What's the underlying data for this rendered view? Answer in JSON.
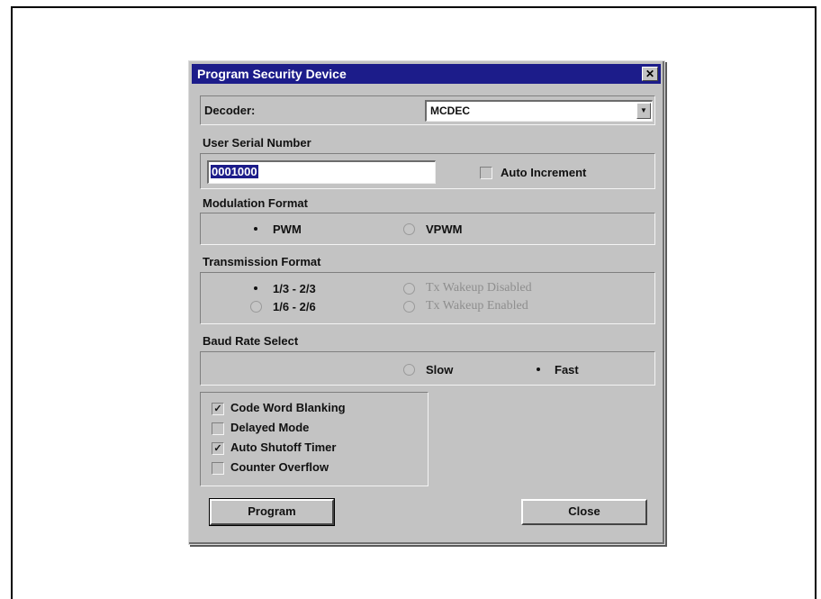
{
  "dialog": {
    "title": "Program Security Device",
    "close_glyph": "✕"
  },
  "decoder": {
    "label": "Decoder:",
    "value": "MCDEC",
    "arrow_glyph": "▼"
  },
  "serial": {
    "label": "User Serial Number",
    "value": "0001000",
    "auto_increment_label": "Auto Increment",
    "auto_increment_checked": false
  },
  "modulation": {
    "label": "Modulation Format",
    "options": [
      {
        "label": "PWM",
        "selected": true,
        "enabled": true
      },
      {
        "label": "VPWM",
        "selected": false,
        "enabled": true
      }
    ]
  },
  "transmission": {
    "label": "Transmission Format",
    "options": [
      {
        "label": "1/3 - 2/3",
        "selected": true,
        "enabled": true
      },
      {
        "label": "1/6 - 2/6",
        "selected": false,
        "enabled": true
      },
      {
        "label": "Tx Wakeup Disabled",
        "selected": false,
        "enabled": false
      },
      {
        "label": "Tx Wakeup Enabled",
        "selected": false,
        "enabled": false
      }
    ]
  },
  "baud": {
    "label": "Baud Rate Select",
    "options": [
      {
        "label": "Slow",
        "selected": false,
        "enabled": true
      },
      {
        "label": "Fast",
        "selected": true,
        "enabled": true
      }
    ]
  },
  "options": {
    "items": [
      {
        "label": "Code Word Blanking",
        "checked": true
      },
      {
        "label": "Delayed Mode",
        "checked": false
      },
      {
        "label": "Auto Shutoff Timer",
        "checked": true
      },
      {
        "label": "Counter Overflow",
        "checked": false
      }
    ],
    "check_glyph": "✓"
  },
  "buttons": {
    "program_label": "Program",
    "close_label": "Close"
  },
  "colors": {
    "titlebar": "#1c1c8a",
    "dialog_face": "#c3c3c3",
    "disabled_text": "#8e8e8e"
  }
}
